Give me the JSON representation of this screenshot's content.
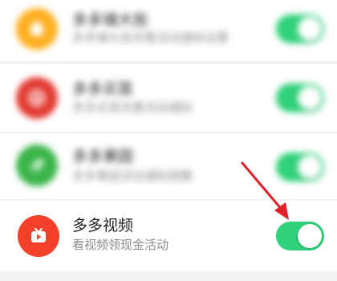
{
  "rows": [
    {
      "title": "多多镇大批",
      "subtitle": "多多镇大批优惠活动通知设置",
      "icon": "coin-bag-icon",
      "icon_color": "#ffb020",
      "enabled": true
    },
    {
      "title": "多多买菜",
      "subtitle": "多多买菜优惠活动通知",
      "icon": "download-icon",
      "icon_color": "#e23b32",
      "enabled": true
    },
    {
      "title": "多多果园",
      "subtitle": "多多果园活动通知提醒",
      "icon": "leaf-icon",
      "icon_color": "#3bb54a",
      "enabled": true
    },
    {
      "title": "多多视频",
      "subtitle": "看视频领现金活动",
      "icon": "tv-play-icon",
      "icon_color": "#f2402b",
      "enabled": true
    }
  ],
  "colors": {
    "toggle_on": "#2fd17a",
    "arrow": "#e2202c"
  }
}
